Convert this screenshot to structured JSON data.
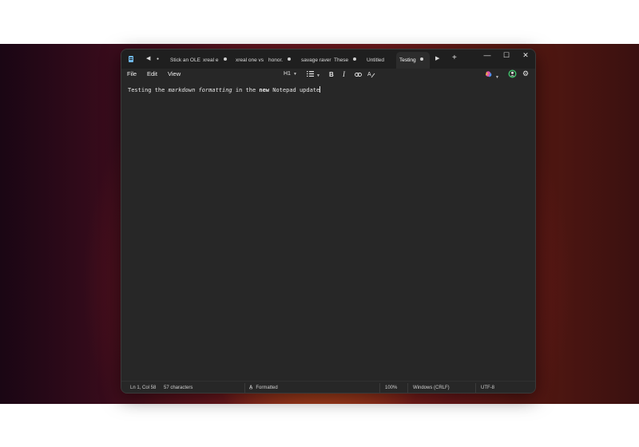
{
  "window": {
    "tabs": [
      {
        "label": "Stick an OLE",
        "has_dot": false
      },
      {
        "label": "xreal e",
        "has_dot": true
      },
      {
        "label": "xreal one vs",
        "has_dot": false
      },
      {
        "label": "honor.",
        "has_dot": true
      },
      {
        "label": "savage raver",
        "has_dot": false
      },
      {
        "label": "These",
        "has_dot": true
      },
      {
        "label": "Untitled",
        "has_dot": false
      },
      {
        "label": "Testing",
        "has_dot": true,
        "active": true
      }
    ],
    "new_tab": "+",
    "prev_arrow": "◀",
    "next_arrow": "▶",
    "minimize": "—",
    "maximize": "☐",
    "close": "✕"
  },
  "menu": {
    "file": "File",
    "edit": "Edit",
    "view": "View"
  },
  "toolbar": {
    "heading": "H1",
    "list_icon": "list-icon",
    "bold": "B",
    "italic": "I",
    "link_icon": "link-icon",
    "clear_format_icon": "clear-formatting-icon",
    "copilot_icon": "copilot-icon",
    "account_icon": "account-sync-icon",
    "settings_icon": "gear-icon"
  },
  "document": {
    "seg1": "Testing the ",
    "seg2_italic": "markdown formatting",
    "seg3": " in the ",
    "seg4_bold": "new",
    "seg5": " Notepad update"
  },
  "status": {
    "position": "Ln 1, Col 58",
    "characters": "57 characters",
    "mode": "Formatted",
    "zoom": "100%",
    "line_ending": "Windows (CRLF)",
    "encoding": "UTF-8"
  },
  "colors": {
    "window_bg": "#272727",
    "titlebar_bg": "#1f1f1f",
    "text": "#e8e8e8",
    "app_icon": "#6fb8e8"
  }
}
